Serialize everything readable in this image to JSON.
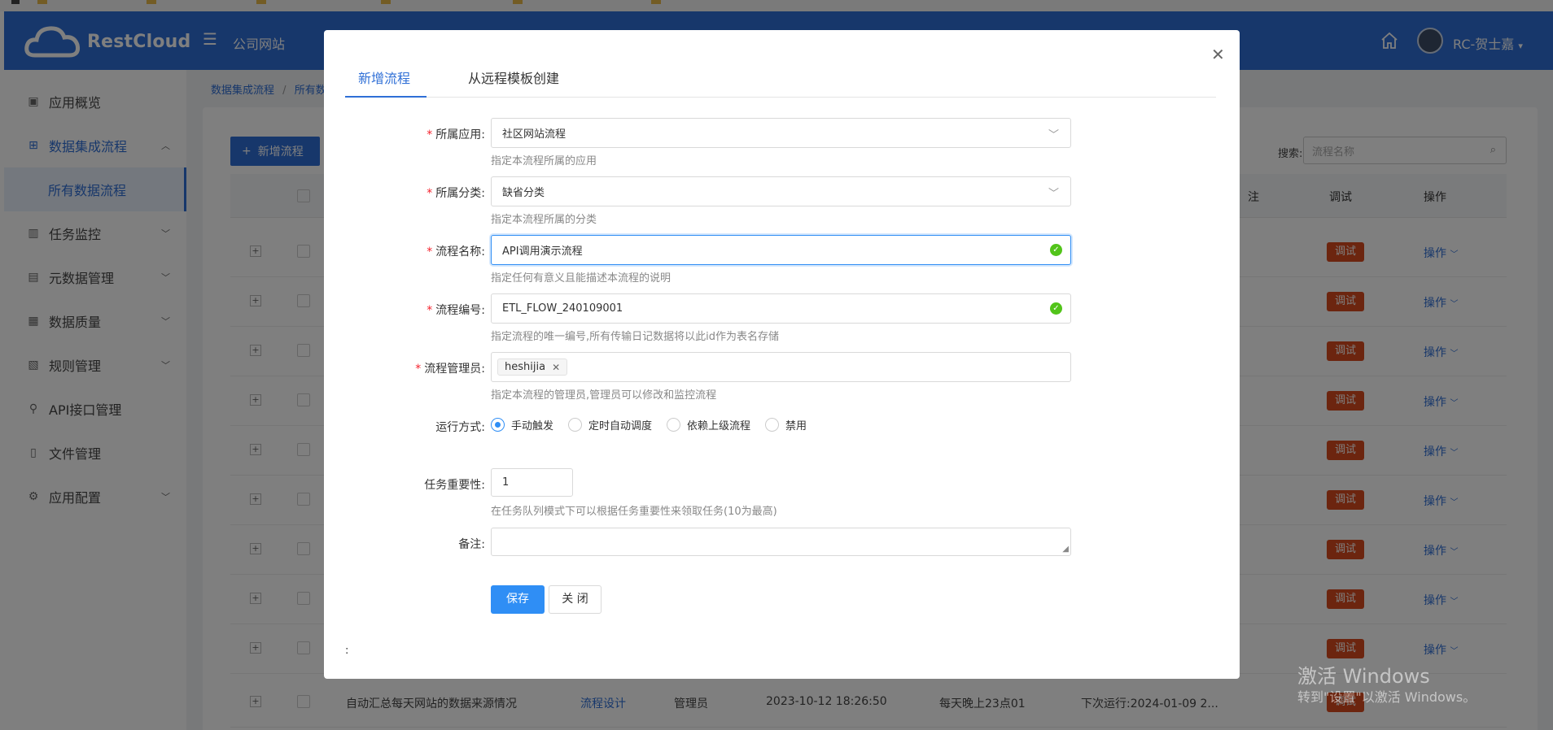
{
  "header": {
    "logo_text": "RestCloud",
    "title": "公司网站",
    "user_name": "RC-贺士嘉"
  },
  "sidebar": {
    "items": [
      {
        "label": "应用概览",
        "icon": "overview-icon"
      },
      {
        "label": "数据集成流程",
        "icon": "grid-icon"
      },
      {
        "label": "所有数据流程",
        "icon": ""
      },
      {
        "label": "任务监控",
        "icon": "monitor-icon"
      },
      {
        "label": "元数据管理",
        "icon": "metadata-icon"
      },
      {
        "label": "数据质量",
        "icon": "quality-icon"
      },
      {
        "label": "规则管理",
        "icon": "rules-icon"
      },
      {
        "label": "API接口管理",
        "icon": "api-icon"
      },
      {
        "label": "文件管理",
        "icon": "file-icon"
      },
      {
        "label": "应用配置",
        "icon": "gear-icon"
      }
    ]
  },
  "background": {
    "breadcrumb": [
      "数据集成流程",
      "/",
      "所有数"
    ],
    "add_button": "新增流程",
    "search_label": "搜索:",
    "search_placeholder": "流程名称",
    "headers": {
      "note": "注",
      "debug": "调试",
      "ops": "操作"
    },
    "debug_label": "调试",
    "ops_label": "操作",
    "last_row": {
      "name": "自动汇总每天网站的数据来源情况",
      "design": "流程设计",
      "admin": "管理员",
      "created": "2023-10-12 18:26:50",
      "schedule": "每天晚上23点01",
      "next_run": "下次运行:2024-01-09 2..."
    }
  },
  "modal": {
    "tabs": [
      "新增流程",
      "从远程模板创建"
    ],
    "fields": {
      "app": {
        "label": "所属应用:",
        "value": "社区网站流程",
        "hint": "指定本流程所属的应用"
      },
      "category": {
        "label": "所属分类:",
        "value": "缺省分类",
        "hint": "指定本流程所属的分类"
      },
      "name": {
        "label": "流程名称:",
        "value": "API调用演示流程",
        "hint": "指定任何有意义且能描述本流程的说明"
      },
      "code": {
        "label": "流程编号:",
        "value": "ETL_FLOW_240109001",
        "hint": "指定流程的唯一编号,所有传输日记数据将以此id作为表名存储"
      },
      "manager": {
        "label": "流程管理员:",
        "tag": "heshijia",
        "hint": "指定本流程的管理员,管理员可以修改和监控流程"
      },
      "run_mode": {
        "label": "运行方式:",
        "options": [
          "手动触发",
          "定时自动调度",
          "依赖上级流程",
          "禁用"
        ],
        "selected": "手动触发"
      },
      "priority": {
        "label": "任务重要性:",
        "value": "1",
        "hint": "在任务队列模式下可以根据任务重要性来领取任务(10为最高)"
      },
      "remark": {
        "label": "备注:",
        "value": ""
      }
    },
    "save_label": "保存",
    "close_label": "关 闭",
    "footer_colon": ":"
  },
  "watermark": {
    "line1": "激活 Windows",
    "line2": "转到\"设置\"以激活 Windows。"
  }
}
